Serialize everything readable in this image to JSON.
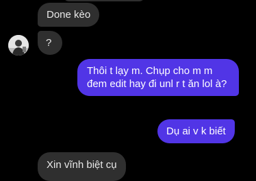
{
  "messages": [
    {
      "text": "Done kèo",
      "direction": "incoming"
    },
    {
      "text": "?",
      "direction": "incoming"
    },
    {
      "text": "Thôi t lạy m. Chụp cho m m đem edit hay đi unl r t ăn lol à?",
      "direction": "outgoing"
    },
    {
      "text": "Dụ ai v k biết",
      "direction": "outgoing"
    },
    {
      "text": "Xin vĩnh biệt cụ",
      "direction": "incoming"
    }
  ],
  "colors": {
    "background": "#000000",
    "incoming_bubble": "#2f2f2f",
    "outgoing_bubble": "#5135e6",
    "text": "#e9e9e9"
  }
}
